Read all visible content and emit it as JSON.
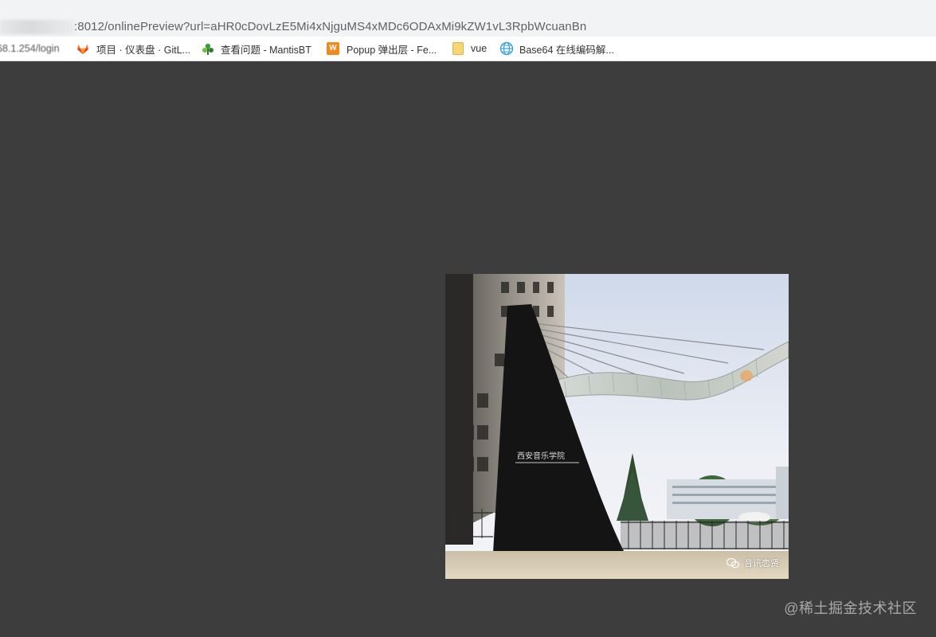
{
  "address_bar": {
    "url": ":8012/onlinePreview?url=aHR0cDovLzE5Mi4xNjguMS4xMDc6ODAxMi9kZW1vL3RpbWcuanBn"
  },
  "bookmarks": [
    {
      "label": "68.1.254/login",
      "icon": "blurred"
    },
    {
      "label": "项目 · 仪表盘 · GitL...",
      "icon": "gitlab-icon"
    },
    {
      "label": "查看问题 - MantisBT",
      "icon": "mantis-icon"
    },
    {
      "label": "Popup 弹出层 - Fe...",
      "icon": "w-icon"
    },
    {
      "label": "vue",
      "icon": "page-icon"
    },
    {
      "label": "Base64 在线编码解...",
      "icon": "base64-icon"
    }
  ],
  "preview": {
    "image_caption": "西安音乐学院",
    "photo_watermark": "音讯恋贤"
  },
  "site_watermark": "@稀土掘金技术社区",
  "colors": {
    "viewer_background": "#3d3d3d",
    "addressbar_background": "#f1f3f4"
  }
}
